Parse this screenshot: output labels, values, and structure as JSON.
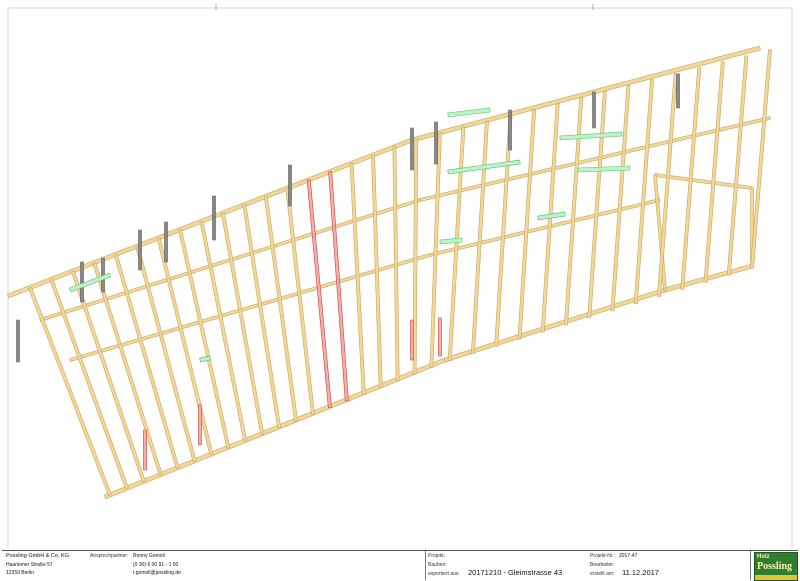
{
  "company": {
    "name": "Possling GmbH & Co. KG",
    "street": "Haarlemer Straße 57",
    "city": "12359 Berlin"
  },
  "contact": {
    "label": "Ansprechpartner:",
    "person": "Ronny Gomoll",
    "phone": "(0 30) 6 00 91 - 1 50",
    "email": "r.gomoll@possling.de"
  },
  "project": {
    "projekt_label": "Projekt:",
    "projekt_value": "",
    "bauherr_label": "Bauherr:",
    "bauherr_value": "",
    "export_label": "exportiert aus:",
    "export_value": "20171210 - Gleimstrasse 43"
  },
  "meta": {
    "nr_label": "Projekt-Nr.:",
    "nr_value": "2017-47",
    "bearbeiter_label": "Bearbeiter:",
    "bearbeiter_value": "",
    "date_label": "erstellt am:",
    "date_value": "11.12.2017"
  },
  "logo": {
    "top": "Holz",
    "name": "Possling"
  },
  "colors": {
    "timber": "#f2d79a",
    "timber_edge": "#c9a55a",
    "steel": "#5a5a5a",
    "red_member": "#d23a3a",
    "green_member": "#4fc36a"
  }
}
